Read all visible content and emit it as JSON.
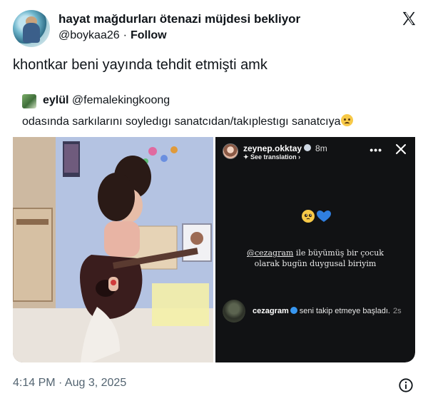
{
  "header": {
    "display_name": "hayat mağdurları ötenazi müjdesi bekliyor",
    "handle": "@boykaa26",
    "separator": "·",
    "follow_label": "Follow"
  },
  "tweet": {
    "text": "khontkar beni yayında tehdit etmişti amk"
  },
  "quote": {
    "display_name": "eylül",
    "handle": "@femalekingkoong",
    "text": "odasında sarkılarını soyledıgı sanatcıdan/takıplestıgı sanatcıya"
  },
  "story": {
    "username": "zeynep.okktay",
    "time": "8m",
    "see_translation": "See translation",
    "more_label": "•••",
    "caption_mention": "@cezagram",
    "caption_text": "ile büyümüş bir çocuk olarak bugün duygusal biriyim",
    "follower": "cezagram",
    "follow_text": "seni takip etmeye başladı.",
    "follow_time": "2s"
  },
  "footer": {
    "timestamp": "4:14 PM · Aug 3, 2025"
  },
  "colors": {
    "text_primary": "#0f1419",
    "text_secondary": "#536471",
    "story_bg": "#111214",
    "verified_blue": "#3897f0",
    "heart_blue": "#2f7fe0"
  },
  "icons": {
    "brand": "x-logo-icon",
    "info": "info-icon",
    "close": "close-icon",
    "verified": "verified-badge-icon"
  }
}
